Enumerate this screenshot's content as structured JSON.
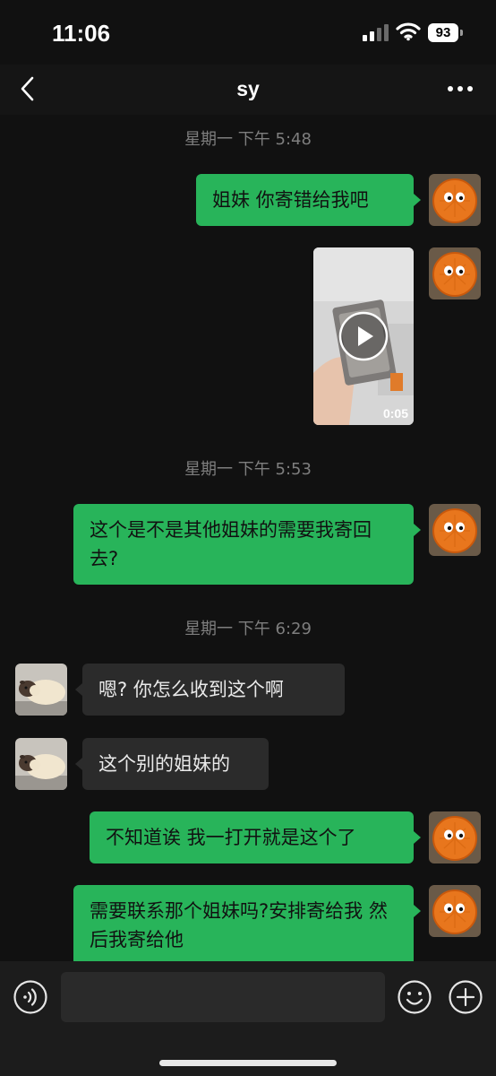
{
  "status_bar": {
    "time": "11:06",
    "battery_level": "93"
  },
  "header": {
    "title": "sy",
    "back_icon": "chevron-left-icon",
    "more_icon": "more-dots-icon"
  },
  "messages": [
    {
      "type": "timestamp",
      "text": "星期一 下午 5:48"
    },
    {
      "type": "text",
      "sender": "me",
      "text": "姐妹 你寄错给我吧"
    },
    {
      "type": "video",
      "sender": "me",
      "duration": "0:05"
    },
    {
      "type": "timestamp",
      "text": "星期一 下午 5:53"
    },
    {
      "type": "text",
      "sender": "me",
      "text": "这个是不是其他姐妹的需要我寄回去?"
    },
    {
      "type": "timestamp",
      "text": "星期一 下午 6:29"
    },
    {
      "type": "text",
      "sender": "them",
      "text": "嗯? 你怎么收到这个啊"
    },
    {
      "type": "text",
      "sender": "them",
      "text": "这个别的姐妹的"
    },
    {
      "type": "text",
      "sender": "me",
      "text": "不知道诶 我一打开就是这个了"
    },
    {
      "type": "text",
      "sender": "me",
      "text": "需要联系那个姐妹吗?安排寄给我 然后我寄给他"
    }
  ],
  "input_bar": {
    "placeholder": "",
    "voice_icon": "voice-icon",
    "emoji_icon": "emoji-icon",
    "plus_icon": "plus-icon"
  },
  "colors": {
    "background": "#111111",
    "my_bubble": "#28b45a",
    "their_bubble": "#2b2b2b",
    "timestamp_text": "#7e7e7e"
  }
}
